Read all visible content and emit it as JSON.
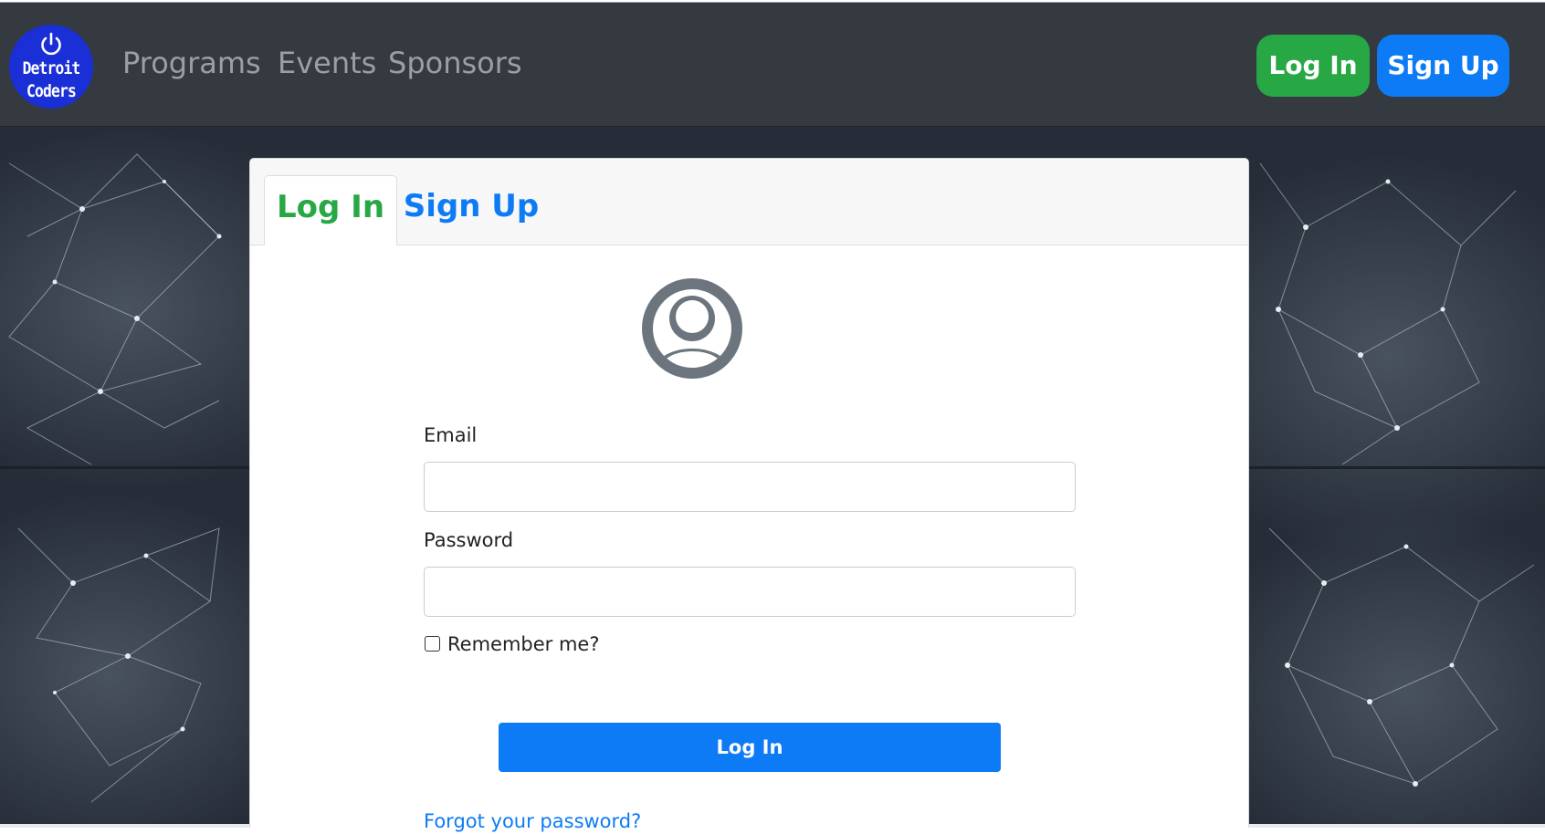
{
  "nav": {
    "logo_line1": "Detroit",
    "logo_line2": "Coders",
    "links": [
      "Programs",
      "Events",
      "Sponsors"
    ],
    "login_label": "Log In",
    "signup_label": "Sign Up"
  },
  "card": {
    "tabs": [
      {
        "label": "Log In",
        "active": true
      },
      {
        "label": "Sign Up",
        "active": false
      }
    ],
    "form": {
      "email_label": "Email",
      "email_value": "",
      "password_label": "Password",
      "password_value": "",
      "remember_label": "Remember me?",
      "remember_checked": false,
      "submit_label": "Log In",
      "forgot_link": "Forgot your password?"
    }
  },
  "icons": [
    "power-icon",
    "user-avatar-icon"
  ],
  "colors": {
    "navbar": "#343a40",
    "success": "#28a745",
    "primary": "#0d7bf5",
    "logo": "#1a2fd6",
    "avatar": "#6c757d"
  }
}
